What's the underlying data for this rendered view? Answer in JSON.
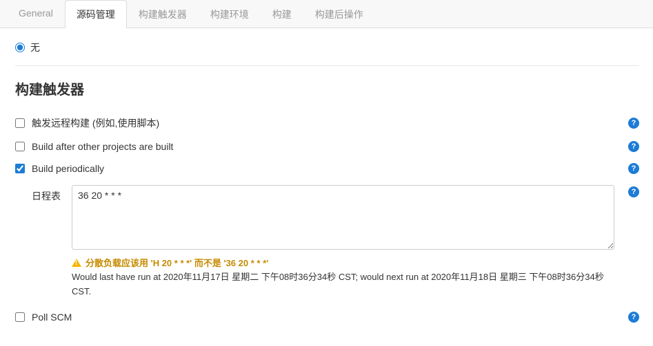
{
  "tabs": {
    "general": "General",
    "scm": "源码管理",
    "triggers": "构建触发器",
    "env": "构建环境",
    "build": "构建",
    "post": "构建后操作"
  },
  "scm": {
    "none": "无"
  },
  "section": {
    "triggers_title": "构建触发器"
  },
  "triggers": {
    "remote": "触发远程构建 (例如,使用脚本)",
    "after_projects": "Build after other projects are built",
    "periodically": "Build periodically",
    "poll_scm": "Poll SCM"
  },
  "schedule": {
    "label": "日程表",
    "value": "36 20 * * *",
    "warning": "分散负载应该用 'H 20 * * *' 而不是 '36 20 * * *'",
    "info": "Would last have run at 2020年11月17日 星期二 下午08时36分34秒 CST; would next run at 2020年11月18日 星期三 下午08时36分34秒 CST."
  },
  "help_glyph": "?"
}
